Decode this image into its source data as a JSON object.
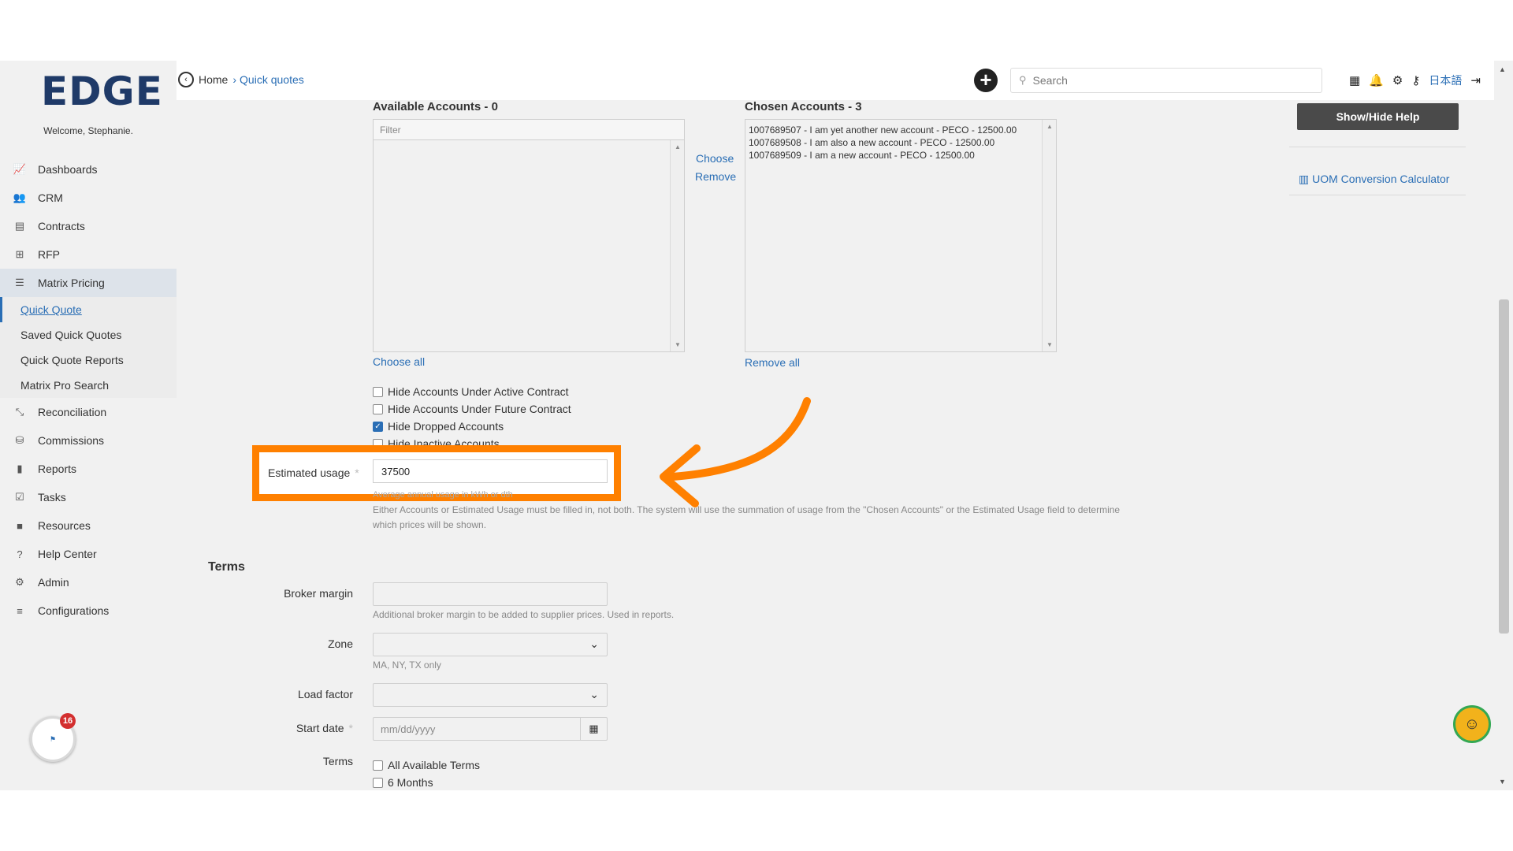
{
  "app": {
    "logo": "EDGE",
    "welcome": "Welcome, Stephanie."
  },
  "sidebar": {
    "items": [
      {
        "label": "Dashboards",
        "icon": "chart-line-icon"
      },
      {
        "label": "CRM",
        "icon": "users-icon"
      },
      {
        "label": "Contracts",
        "icon": "document-icon"
      },
      {
        "label": "RFP",
        "icon": "sitemap-icon"
      },
      {
        "label": "Matrix Pricing",
        "icon": "list-icon"
      },
      {
        "label": "Reconciliation",
        "icon": "compress-icon"
      },
      {
        "label": "Commissions",
        "icon": "coins-icon"
      },
      {
        "label": "Reports",
        "icon": "bar-chart-icon"
      },
      {
        "label": "Tasks",
        "icon": "tasks-icon"
      },
      {
        "label": "Resources",
        "icon": "folder-icon"
      },
      {
        "label": "Help Center",
        "icon": "question-icon"
      },
      {
        "label": "Admin",
        "icon": "cogs-icon"
      },
      {
        "label": "Configurations",
        "icon": "sliders-icon"
      }
    ],
    "sub_items": [
      "Quick Quote",
      "Saved Quick Quotes",
      "Quick Quote Reports",
      "Matrix Pro Search"
    ],
    "badge_count": "16"
  },
  "topbar": {
    "home": "Home",
    "separator": "›",
    "current": "Quick quotes",
    "search_placeholder": "Search",
    "language": "日本語"
  },
  "accounts": {
    "available_title": "Available Accounts - 0",
    "chosen_title": "Chosen Accounts - 3",
    "filter_placeholder": "Filter",
    "choose": "Choose",
    "remove": "Remove",
    "choose_all": "Choose all",
    "remove_all": "Remove all",
    "chosen_list": [
      "1007689507 - I am yet another new account - PECO - 12500.00",
      "1007689508 - I am also a new account - PECO - 12500.00",
      "1007689509 - I am a new account - PECO - 12500.00"
    ],
    "checkboxes": [
      {
        "label": "Hide Accounts Under Active Contract",
        "checked": false
      },
      {
        "label": "Hide Accounts Under Future Contract",
        "checked": false
      },
      {
        "label": "Hide Dropped Accounts",
        "checked": true
      },
      {
        "label": "Hide Inactive Accounts",
        "checked": false
      }
    ]
  },
  "estimated_usage": {
    "label": "Estimated usage",
    "required_mark": "*",
    "value": "37500",
    "hint": "Average annual usage in kWh or dth",
    "note_line1": "Either Accounts or Estimated Usage must be filled in, not both. The system will use the summation of usage from the \"Chosen Accounts\" or the Estimated Usage field to determine",
    "note_line2": "which prices will be shown."
  },
  "right_panel": {
    "help_button": "Show/Hide Help",
    "uom_link": "UOM Conversion Calculator"
  },
  "terms": {
    "heading": "Terms",
    "broker_margin_label": "Broker margin",
    "broker_margin_value": "",
    "broker_margin_hint": "Additional broker margin to be added to supplier prices. Used in reports.",
    "zone_label": "Zone",
    "zone_value": "",
    "zone_hint": "MA, NY, TX only",
    "load_factor_label": "Load factor",
    "load_factor_value": "",
    "start_date_label": "Start date",
    "start_date_placeholder": "mm/dd/yyyy",
    "terms_label": "Terms",
    "term_options": [
      "All Available Terms",
      "6 Months"
    ]
  },
  "colors": {
    "accent": "#2a6eb5",
    "highlight": "#ff8000",
    "sidebar_active": "#dde3ea"
  }
}
